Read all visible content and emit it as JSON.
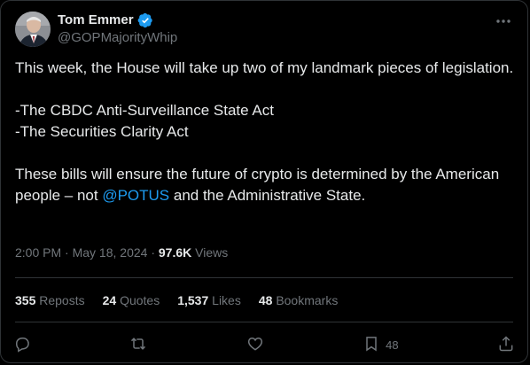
{
  "author": {
    "name": "Tom Emmer",
    "handle": "@GOPMajorityWhip"
  },
  "tweet": {
    "line1": "This week, the House will take up two of my landmark pieces of legislation.",
    "bill1": "-The CBDC Anti-Surveillance State Act",
    "bill2": "-The Securities Clarity Act",
    "line3_before": "These bills will ensure the future of crypto is determined by the American people – not ",
    "mention": "@POTUS",
    "line3_after": " and the Administrative State."
  },
  "meta": {
    "time": "2:00 PM",
    "sep1": " · ",
    "date": "May 18, 2024",
    "sep2": " · ",
    "views_count": "97.6K",
    "views_label": " Views"
  },
  "stats": {
    "reposts_count": "355",
    "reposts_label": "Reposts",
    "quotes_count": "24",
    "quotes_label": "Quotes",
    "likes_count": "1,537",
    "likes_label": "Likes",
    "bookmarks_count": "48",
    "bookmarks_label": "Bookmarks"
  },
  "actions": {
    "bookmark_count": "48",
    "icons": [
      "reply-icon",
      "repost-icon",
      "like-icon",
      "bookmark-icon",
      "share-icon"
    ]
  },
  "colors": {
    "background": "#000000",
    "text": "#e7e9ea",
    "muted": "#71767b",
    "link": "#1d9bf0",
    "border": "#2f3336"
  }
}
